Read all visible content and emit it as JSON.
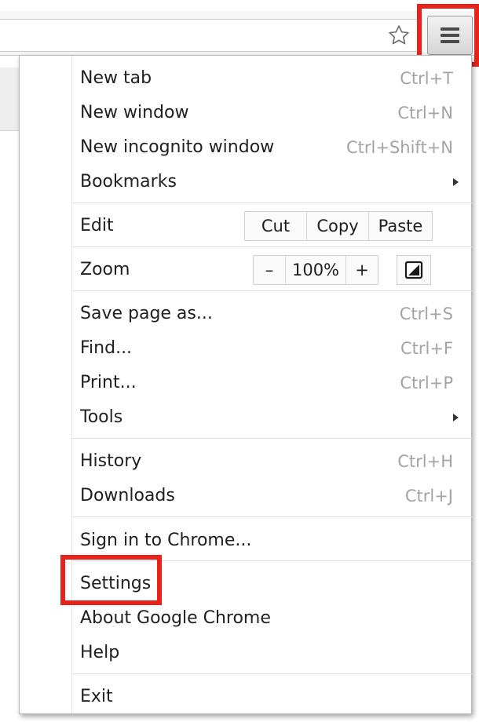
{
  "toolbar": {
    "star_icon": "star-outline-icon",
    "menu_icon": "hamburger-menu-icon"
  },
  "menu": {
    "new_tab": {
      "label": "New tab",
      "shortcut": "Ctrl+T"
    },
    "new_window": {
      "label": "New window",
      "shortcut": "Ctrl+N"
    },
    "new_incognito": {
      "label": "New incognito window",
      "shortcut": "Ctrl+Shift+N"
    },
    "bookmarks": {
      "label": "Bookmarks"
    },
    "edit": {
      "label": "Edit",
      "cut": "Cut",
      "copy": "Copy",
      "paste": "Paste"
    },
    "zoom": {
      "label": "Zoom",
      "minus": "–",
      "value": "100%",
      "plus": "+"
    },
    "save_page": {
      "label": "Save page as...",
      "shortcut": "Ctrl+S"
    },
    "find": {
      "label": "Find...",
      "shortcut": "Ctrl+F"
    },
    "print": {
      "label": "Print...",
      "shortcut": "Ctrl+P"
    },
    "tools": {
      "label": "Tools"
    },
    "history": {
      "label": "History",
      "shortcut": "Ctrl+H"
    },
    "downloads": {
      "label": "Downloads",
      "shortcut": "Ctrl+J"
    },
    "sign_in": {
      "label": "Sign in to Chrome..."
    },
    "settings": {
      "label": "Settings"
    },
    "about": {
      "label": "About Google Chrome"
    },
    "help": {
      "label": "Help"
    },
    "exit": {
      "label": "Exit"
    }
  },
  "highlight_color": "#e8231b"
}
